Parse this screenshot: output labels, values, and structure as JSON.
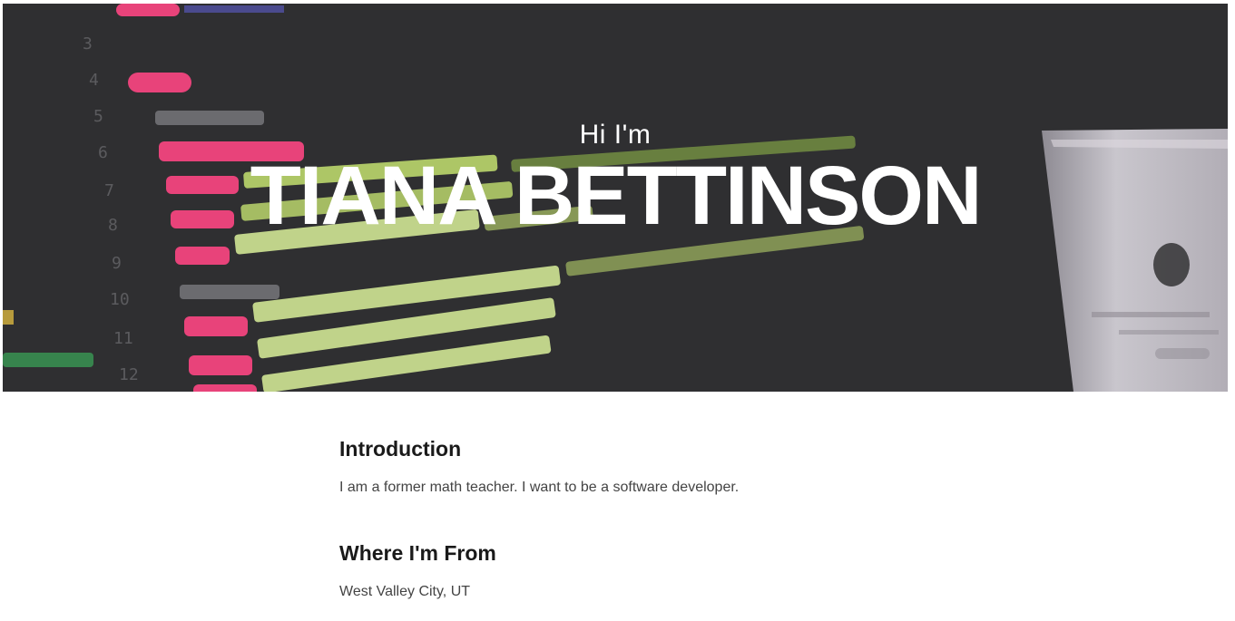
{
  "hero": {
    "greeting": "Hi I'm",
    "name": "TIANA BETTINSON"
  },
  "sections": [
    {
      "title": "Introduction",
      "text": "I am a former math teacher. I want to be a software developer."
    },
    {
      "title": "Where I'm From",
      "text": "West Valley City, UT"
    }
  ],
  "colors": {
    "hero_bg": "#2f2f31",
    "hero_text": "#ffffff",
    "heading": "#1a1a1a",
    "body_text": "#444444"
  }
}
